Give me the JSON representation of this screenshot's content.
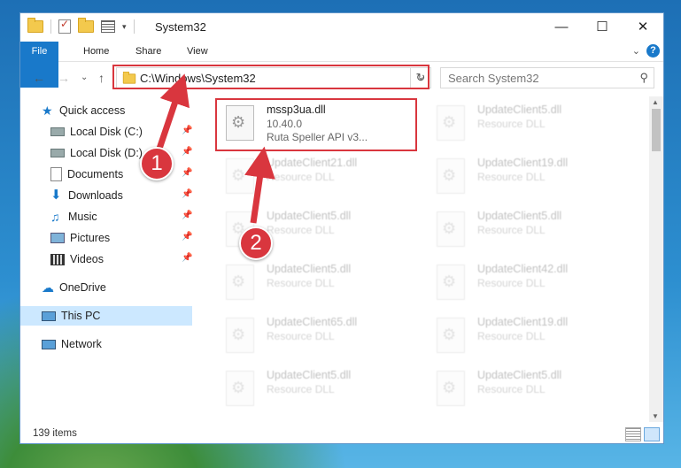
{
  "window": {
    "title": "System32"
  },
  "ribbon": {
    "tabs": [
      "File",
      "Home",
      "Share",
      "View"
    ]
  },
  "address": {
    "path": "C:\\Windows\\System32",
    "search_placeholder": "Search System32"
  },
  "sidebar": {
    "items": [
      {
        "label": "Quick access",
        "icon": "star-icon"
      },
      {
        "label": "Local Disk (C:)",
        "icon": "drive-icon",
        "pinned": true
      },
      {
        "label": "Local Disk (D:)",
        "icon": "drive-icon",
        "pinned": true
      },
      {
        "label": "Documents",
        "icon": "documents-icon",
        "pinned": true
      },
      {
        "label": "Downloads",
        "icon": "download-icon",
        "pinned": true
      },
      {
        "label": "Music",
        "icon": "music-icon",
        "pinned": true
      },
      {
        "label": "Pictures",
        "icon": "pictures-icon",
        "pinned": true
      },
      {
        "label": "Videos",
        "icon": "videos-icon",
        "pinned": true
      },
      {
        "label": "OneDrive",
        "icon": "cloud-icon"
      },
      {
        "label": "This PC",
        "icon": "computer-icon",
        "selected": true
      },
      {
        "label": "Network",
        "icon": "network-icon"
      }
    ]
  },
  "files": [
    {
      "name": "mssp3ua.dll",
      "line1": "10.40.0",
      "line2": "Ruta Speller API v3..."
    },
    {
      "name": "UpdateClient5.dll",
      "line1": "Resource DLL"
    },
    {
      "name": "UpdateClient21.dll",
      "line1": "Resource DLL"
    },
    {
      "name": "UpdateClient19.dll",
      "line1": "Resource DLL"
    },
    {
      "name": "UpdateClient5.dll",
      "line1": "Resource DLL"
    },
    {
      "name": "UpdateClient5.dll",
      "line1": "Resource DLL"
    },
    {
      "name": "UpdateClient5.dll",
      "line1": "Resource DLL"
    },
    {
      "name": "UpdateClient42.dll",
      "line1": "Resource DLL"
    },
    {
      "name": "UpdateClient65.dll",
      "line1": "Resource DLL"
    },
    {
      "name": "UpdateClient19.dll",
      "line1": "Resource DLL"
    },
    {
      "name": "UpdateClient5.dll",
      "line1": "Resource DLL"
    },
    {
      "name": "UpdateClient5.dll",
      "line1": "Resource DLL"
    }
  ],
  "status": {
    "item_count": "139 items"
  },
  "callouts": [
    "1",
    "2"
  ],
  "colors": {
    "accent": "#1979ca",
    "highlight": "#d9363e",
    "selected": "#cce8ff"
  }
}
